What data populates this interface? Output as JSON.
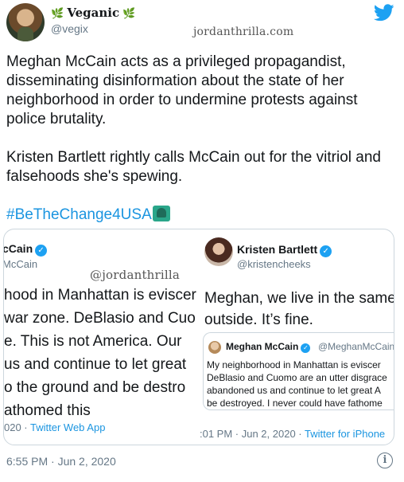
{
  "author": {
    "display_name": "Veganic",
    "leaf_left": "🌿",
    "leaf_right": "🌿",
    "handle": "@vegix",
    "avatar_icon": "avatar",
    "logo_icon": "twitter-bird-icon"
  },
  "watermark_top": "jordanthrilla.com",
  "tweet": {
    "paragraph1": "Meghan McCain acts as a privileged propagandist, disseminating disinformation about the state of her neighborhood in order to undermine protests against police brutality.",
    "paragraph2": "Kristen Bartlett rightly calls McCain out for the vitriol and falsehoods she's spewing.",
    "hashtag": "#BeTheChange4USA",
    "timestamp": "6:55 PM · Jun 2, 2020"
  },
  "embedded_left": {
    "name": "cCain",
    "handle": "McCain",
    "watermark": "@jordanthrilla",
    "body": "hood in Manhattan is eviscer\nwar zone. DeBlasio and Cuo\ne. This is not America. Our\nus and continue to let great\no the ground and be destro\nathomed this",
    "footer_time": "020 · ",
    "footer_source": "Twitter Web App"
  },
  "embedded_right": {
    "name": "Kristen Bartlett",
    "handle": "@kristencheeks",
    "body": "Meghan, we live in the same\noutside. It’s fine.",
    "quote": {
      "name": "Meghan McCain",
      "handle": "@MeghanMcCain",
      "body": "My neighborhood in Manhattan is eviscer\nDeBlasio and Cuomo are an utter disgrace\nabandoned us and continue to let great A\nbe destroyed. I never could have fathome"
    },
    "footer_time": ":01 PM · Jun 2, 2020 · ",
    "footer_source": "Twitter for iPhone"
  },
  "colors": {
    "link": "#1b95e0",
    "muted": "#657786",
    "twitter_blue": "#1da1f2"
  }
}
